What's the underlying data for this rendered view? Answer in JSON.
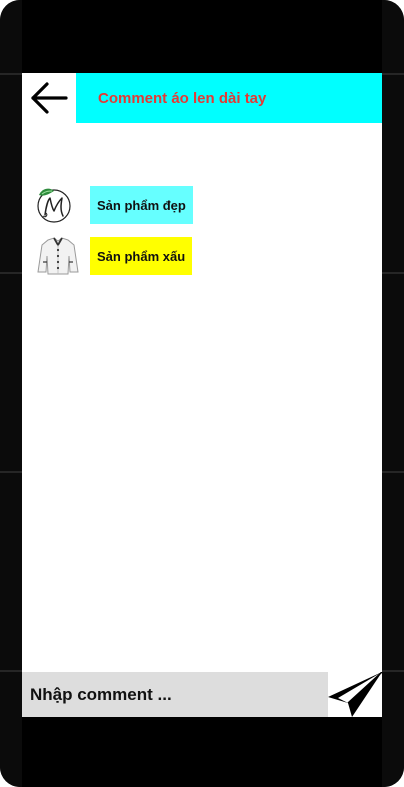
{
  "header": {
    "title": "Comment áo len dài tay",
    "back_icon": "arrow-left-icon",
    "title_bar_color": "#00ffff",
    "title_color": "#e53935"
  },
  "comments": [
    {
      "avatar": "logo-m-leaf-avatar",
      "text": "Sản phẩm đẹp",
      "bubble_color": "#66ffff"
    },
    {
      "avatar": "white-shirt-avatar",
      "text": "Sản phẩm xấu",
      "bubble_color": "#ffff00"
    }
  ],
  "composer": {
    "placeholder": "Nhập comment ...",
    "send_icon": "paper-plane-icon"
  }
}
